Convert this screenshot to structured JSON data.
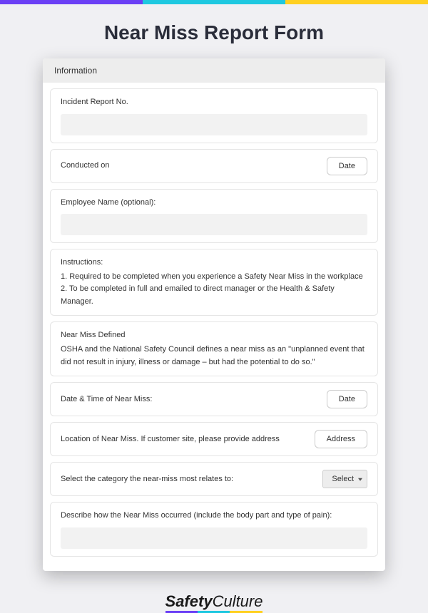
{
  "page_title": "Near Miss Report Form",
  "section_header": "Information",
  "fields": {
    "incident_report_no_label": "Incident Report No.",
    "conducted_on_label": "Conducted on",
    "conducted_on_button": "Date",
    "employee_name_label": "Employee Name (optional):",
    "instructions_lead": "Instructions:",
    "instructions_line1": "1. Required to be completed when you experience a Safety Near Miss in the workplace",
    "instructions_line2": "2. To be completed in full and emailed to direct manager or the Health & Safety Manager.",
    "defined_lead": "Near Miss Defined",
    "defined_body": "OSHA and the National Safety Council defines a near miss as an \"unplanned event that did not result in injury, illness or damage – but had the potential to do so.\"",
    "datetime_label": "Date & Time of Near Miss:",
    "datetime_button": "Date",
    "location_label": "Location of Near Miss. If customer site, please provide address",
    "location_button": "Address",
    "category_label": "Select the category the near-miss most relates to:",
    "category_button": "Select",
    "describe_label": "Describe how the Near Miss occurred (include the body part and type of pain):"
  },
  "logo": {
    "part1": "Safety",
    "part2": "Culture"
  }
}
